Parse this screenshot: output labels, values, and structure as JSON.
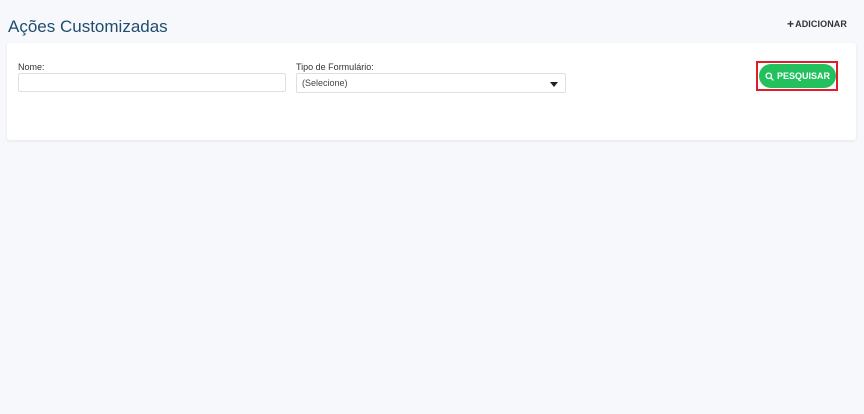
{
  "header": {
    "title": "Ações Customizadas",
    "add_label": "ADICIONAR",
    "add_icon": "plus-icon"
  },
  "filters": {
    "name": {
      "label": "Nome:",
      "value": "",
      "placeholder": ""
    },
    "form_type": {
      "label": "Tipo de Formulário:",
      "selected": "(Selecione)",
      "icon": "chevron-down-icon"
    },
    "search_button": {
      "label": "PESQUISAR",
      "icon": "search-icon"
    }
  },
  "colors": {
    "title": "#1f4d6b",
    "accent": "#22c15e",
    "highlight": "#e01e2a",
    "background": "#f7f8fc"
  }
}
